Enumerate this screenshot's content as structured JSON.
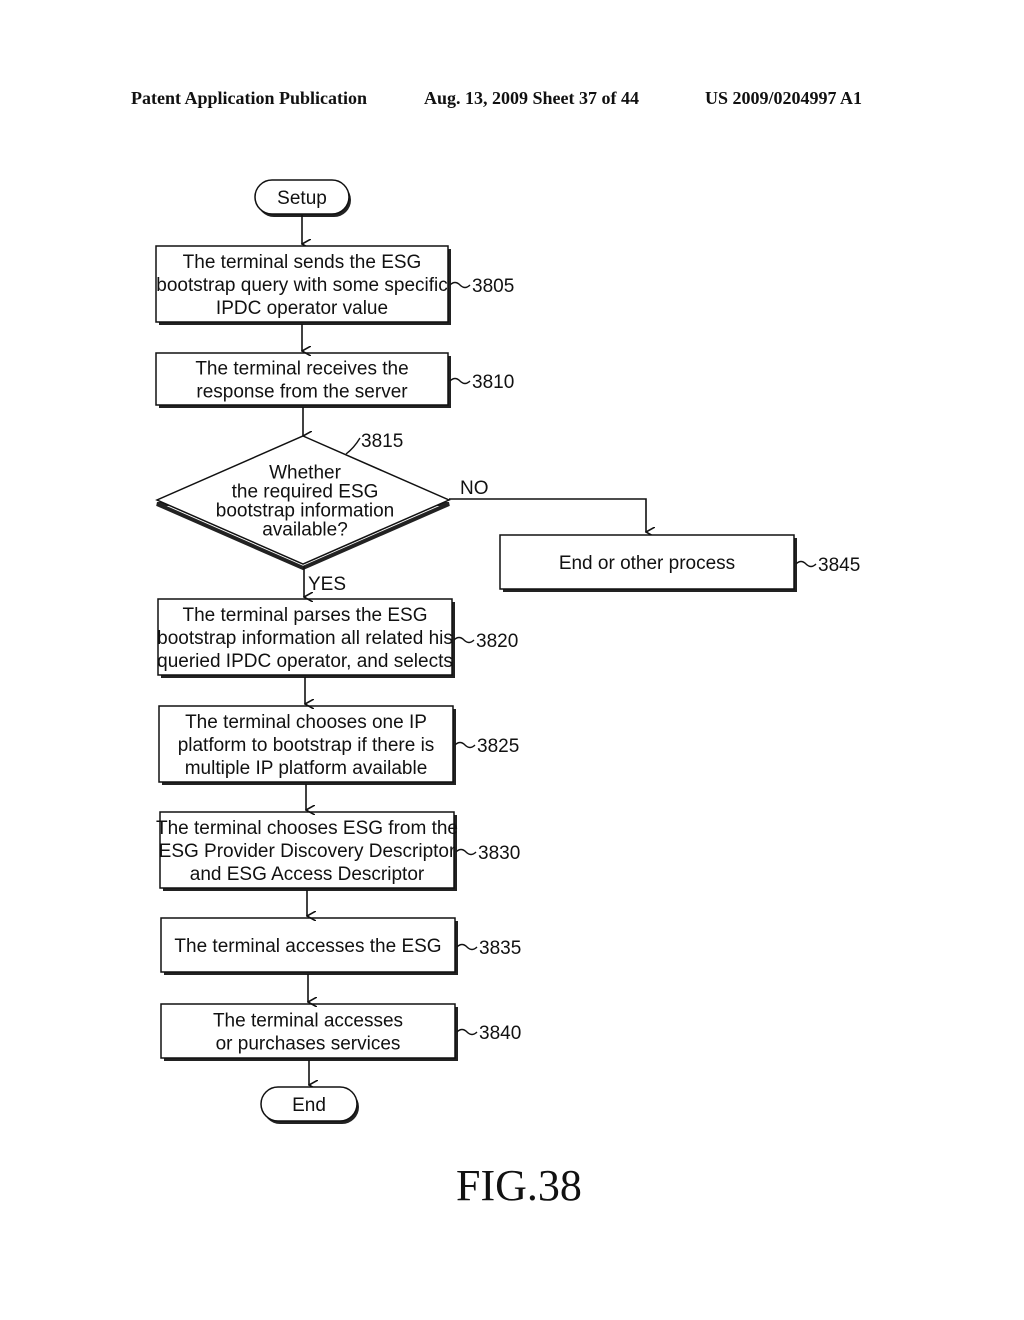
{
  "header": {
    "publication": "Patent Application Publication",
    "date_sheet": "Aug. 13, 2009  Sheet 37 of 44",
    "patent_number": "US 2009/0204997 A1"
  },
  "flowchart": {
    "start": "Setup",
    "end": "End",
    "steps": [
      {
        "ref": "3805",
        "lines": [
          "The terminal sends the ESG",
          "bootstrap query with some specific",
          "IPDC operator value"
        ]
      },
      {
        "ref": "3810",
        "lines": [
          "The terminal receives the",
          "response from the server"
        ]
      },
      {
        "ref": "3820",
        "lines": [
          "The terminal parses the ESG",
          "bootstrap information all related his",
          "queried IPDC operator, and selects"
        ]
      },
      {
        "ref": "3825",
        "lines": [
          "The terminal chooses one IP",
          "platform to bootstrap if there is",
          "multiple IP platform available"
        ]
      },
      {
        "ref": "3830",
        "lines": [
          "The terminal chooses ESG from the",
          "ESG Provider Discovery Descriptor",
          "and ESG Access Descriptor"
        ]
      },
      {
        "ref": "3835",
        "lines": [
          "The terminal accesses the ESG"
        ]
      },
      {
        "ref": "3840",
        "lines": [
          "The terminal accesses",
          "or purchases services"
        ]
      }
    ],
    "decision": {
      "ref": "3815",
      "lines": [
        "Whether",
        "the required ESG",
        "bootstrap information",
        "available?"
      ],
      "yes_label": "YES",
      "no_label": "NO"
    },
    "alternate": {
      "ref": "3845",
      "lines": [
        "End or other process"
      ]
    }
  },
  "figure_label": "FIG.38"
}
